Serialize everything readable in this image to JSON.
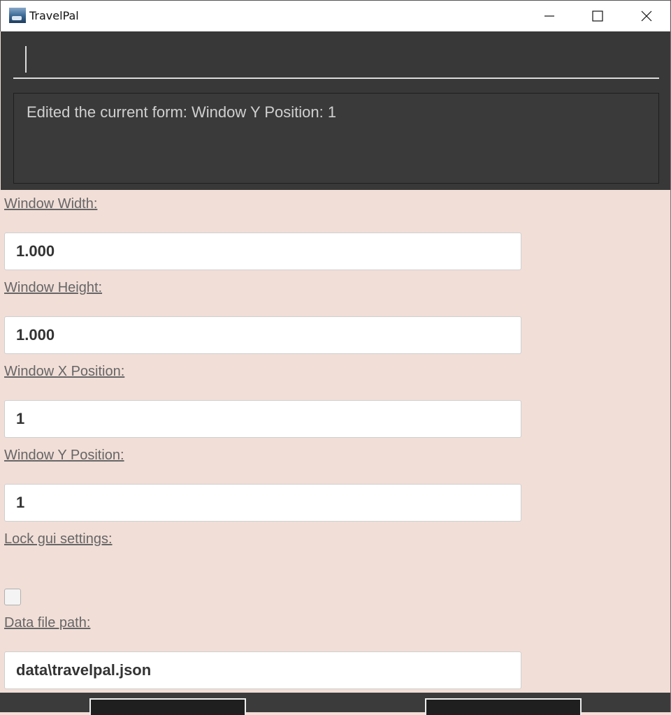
{
  "window": {
    "title": "TravelPal",
    "minimize_icon": "minimize-icon",
    "maximize_icon": "maximize-icon",
    "close_icon": "close-icon"
  },
  "command": {
    "value": "",
    "result": "Edited the current form: Window Y Position: 1"
  },
  "form": {
    "window_width_label": "Window Width: ",
    "window_width_value": "1.000",
    "window_height_label": "Window Height: ",
    "window_height_value": "1.000",
    "window_x_label": "Window X Position: ",
    "window_x_value": "1",
    "window_y_label": "Window Y Position: ",
    "window_y_value": "1",
    "lock_label": "Lock gui settings: ",
    "lock_checked": false,
    "data_path_label": "Data file path: ",
    "data_path_value": "data\\travelpal.json"
  },
  "colors": {
    "background": "#f1ded7",
    "command_panel": "#383838",
    "title_bar": "#ffffff"
  }
}
